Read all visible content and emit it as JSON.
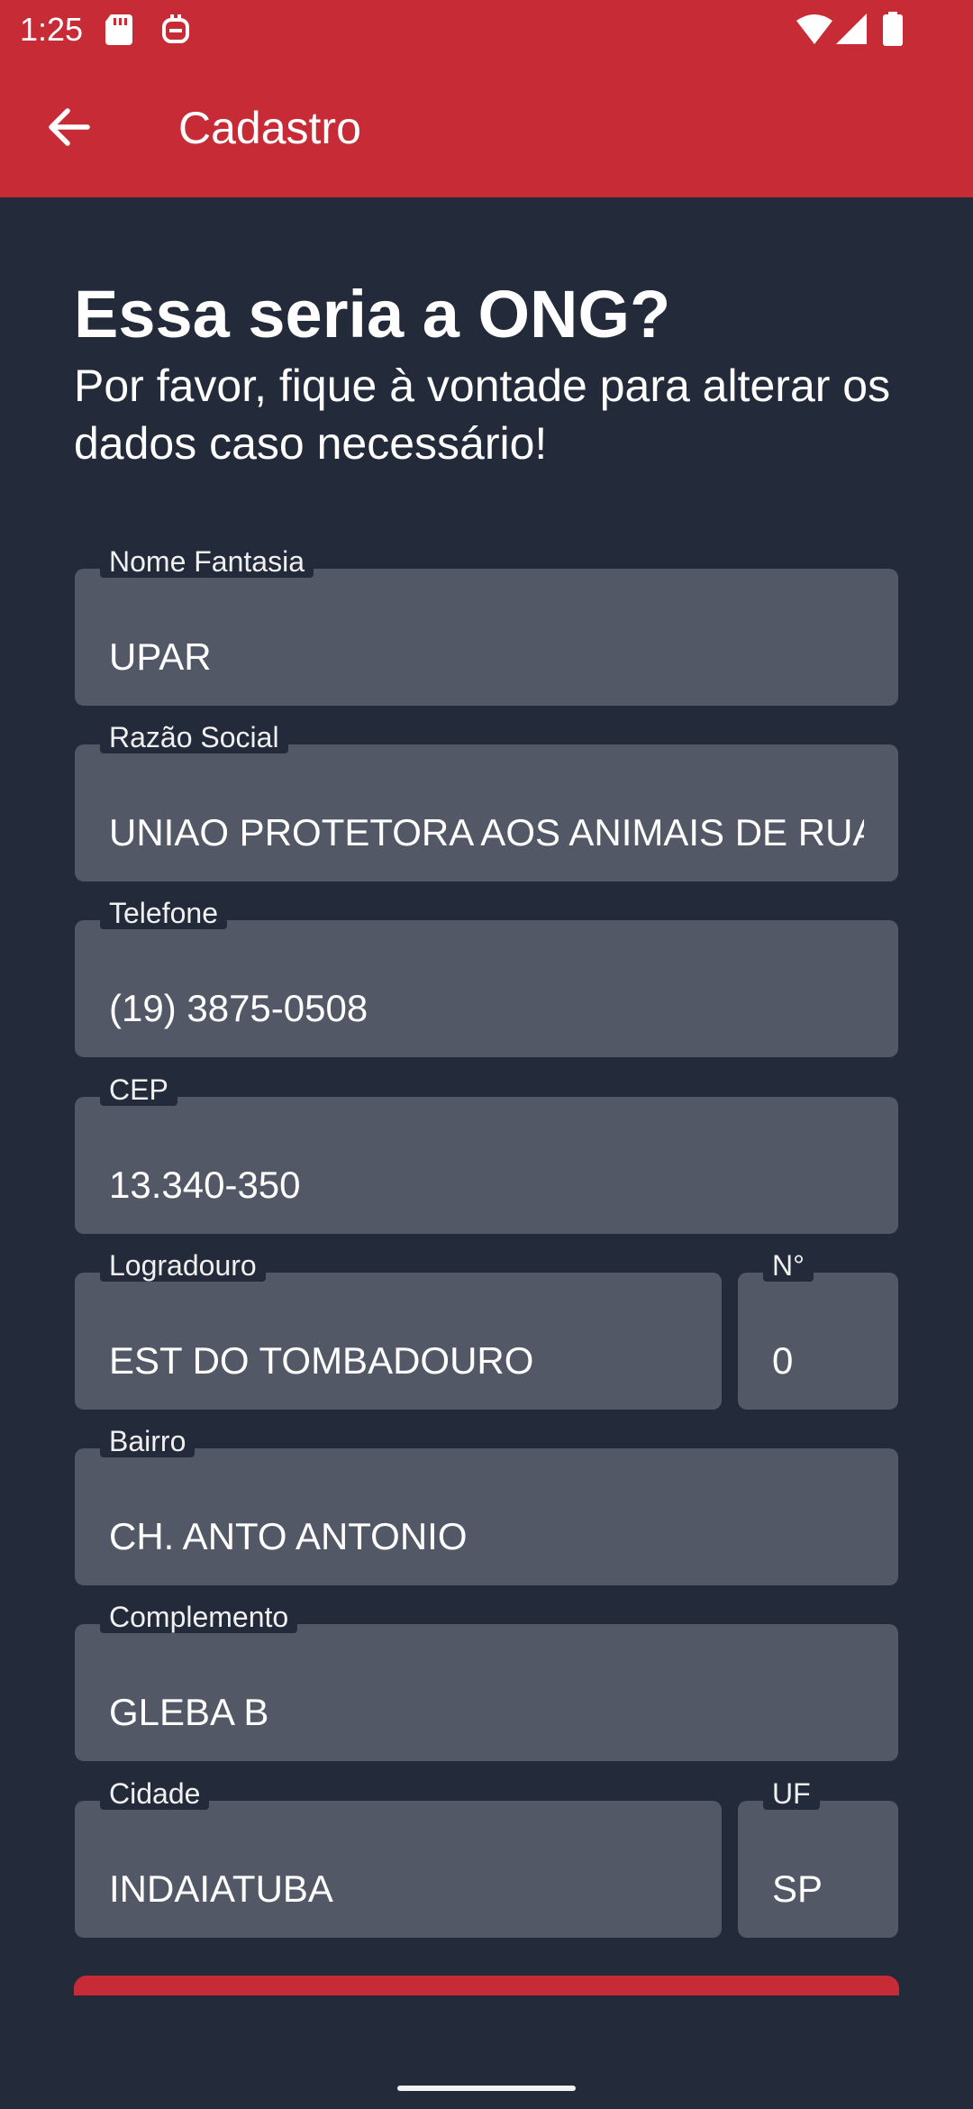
{
  "status_bar": {
    "time": "1:25",
    "icons": [
      "sd-card-icon",
      "app-notification-icon",
      "wifi-icon",
      "signal-icon",
      "battery-icon"
    ]
  },
  "app_bar": {
    "title": "Cadastro",
    "back_icon": "arrow-back-icon",
    "color": "#c62b36"
  },
  "header": {
    "title": "Essa seria a ONG?",
    "subtitle": "Por favor, fique à vontade para alterar os dados caso necessário!"
  },
  "form": {
    "nome_fantasia": {
      "label": "Nome Fantasia",
      "value": "UPAR"
    },
    "razao_social": {
      "label": "Razão Social",
      "value": "UNIAO PROTETORA AOS ANIMAIS DE RUA"
    },
    "telefone": {
      "label": "Telefone",
      "value": "(19) 3875-0508"
    },
    "cep": {
      "label": "CEP",
      "value": "13.340-350"
    },
    "logradouro": {
      "label": "Logradouro",
      "value": "EST DO TOMBADOURO"
    },
    "numero": {
      "label": "N°",
      "value": "0"
    },
    "bairro": {
      "label": "Bairro",
      "value": "CH. ANTO ANTONIO"
    },
    "complemento": {
      "label": "Complemento",
      "value": "GLEBA B"
    },
    "cidade": {
      "label": "Cidade",
      "value": "INDAIATUBA"
    },
    "uf": {
      "label": "UF",
      "value": "SP"
    }
  },
  "colors": {
    "background": "#232a3a",
    "field": "#525866",
    "accent": "#c62b36"
  }
}
